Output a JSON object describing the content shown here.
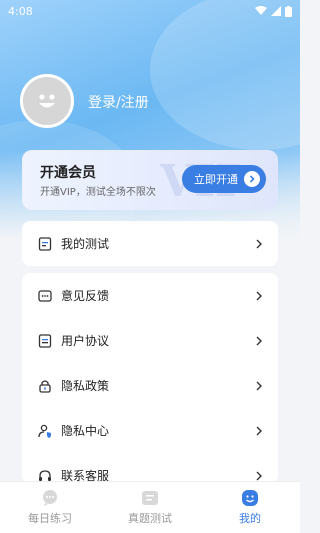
{
  "status": {
    "time": "4:08",
    "icons": [
      "wifi-icon",
      "signal-icon",
      "battery-icon"
    ]
  },
  "profile": {
    "login_label": "登录/注册",
    "avatar_icon": "avatar-icon"
  },
  "vip": {
    "title": "开通会员",
    "subtitle": "开通VIP，测试全场不限次",
    "button_label": "立即开通",
    "watermark": "VIP",
    "button_color": "#3a7ee4"
  },
  "menu_top": [
    {
      "label": "我的测试",
      "icon": "test-doc-icon"
    }
  ],
  "menu": [
    {
      "label": "意见反馈",
      "icon": "feedback-icon"
    },
    {
      "label": "用户协议",
      "icon": "agreement-icon"
    },
    {
      "label": "隐私政策",
      "icon": "lock-icon"
    },
    {
      "label": "隐私中心",
      "icon": "user-shield-icon"
    },
    {
      "label": "联系客服",
      "icon": "headset-icon"
    }
  ],
  "tabs": [
    {
      "label": "每日练习",
      "icon": "chat-icon",
      "active": false
    },
    {
      "label": "真题测试",
      "icon": "scroll-icon",
      "active": false
    },
    {
      "label": "我的",
      "icon": "smile-user-icon",
      "active": true
    }
  ],
  "colors": {
    "accent": "#3a7ee4",
    "hero": "#6bb8f3"
  }
}
